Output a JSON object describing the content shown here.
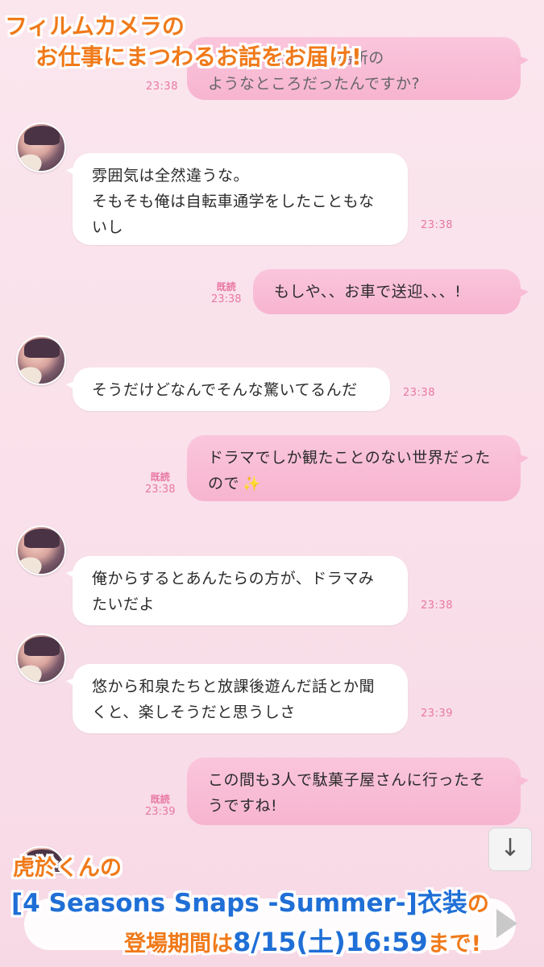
{
  "promo_top": {
    "line1": "フィルムカメラの",
    "line2": "お仕事にまつわるお話をお届け!"
  },
  "messages": [
    {
      "side": "right",
      "lines": [
        "えっと、撮影場所の",
        "ようなところだったんですか?"
      ],
      "time": "23:38",
      "read": ""
    },
    {
      "side": "left",
      "lines": [
        "雰囲気は全然違うな。",
        "そもそも俺は自転車通学をしたこともな",
        "いし"
      ],
      "time": "23:38"
    },
    {
      "side": "right",
      "lines": [
        "もしや、、お車で送迎、、、!"
      ],
      "time": "23:38",
      "read": "既読"
    },
    {
      "side": "left",
      "lines": [
        "そうだけどなんでそんな驚いてるんだ"
      ],
      "time": "23:38"
    },
    {
      "side": "right",
      "lines": [
        "ドラマでしか観たことのない世界だった",
        "ので"
      ],
      "time": "23:38",
      "read": "既読",
      "emoji": "✨"
    },
    {
      "side": "left",
      "lines": [
        "俺からするとあんたらの方が、ドラマみ",
        "たいだよ"
      ],
      "time": "23:38"
    },
    {
      "side": "left",
      "lines": [
        "悠から和泉たちと放課後遊んだ話とか聞",
        "くと、楽しそうだと思うしさ"
      ],
      "time": "23:39"
    },
    {
      "side": "right",
      "lines": [
        "この間も3人で駄菓子屋さんに行ったそ",
        "うですね!"
      ],
      "time": "23:39",
      "read": "既読"
    }
  ],
  "promo_bottom": {
    "line1": "虎於くんの",
    "line2_title": "[4 Seasons Snaps -Summer-]衣装",
    "line2_suffix": "の",
    "line3_prefix": "登場期間は",
    "line3_date": "8/15(土)16:59",
    "line3_suffix": "まで!"
  },
  "scroll_button_icon": "arrow-down-icon",
  "colors": {
    "accent_orange": "#f07a1a",
    "accent_blue": "#1f6fd6",
    "bubble_pink": "#f8bdd5",
    "timestamp_pink": "#e878a2"
  }
}
